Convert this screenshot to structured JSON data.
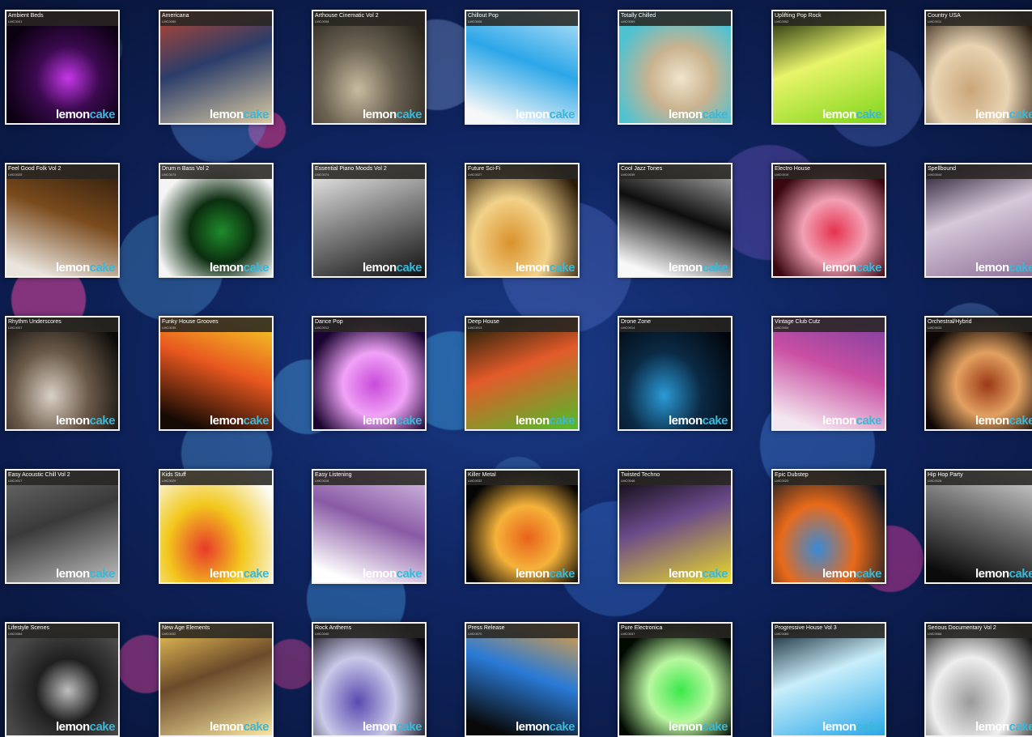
{
  "brand": {
    "logo_part_1": "lemon",
    "logo_part_2": "cake",
    "accent_color": "#3ab8d8"
  },
  "albums": [
    {
      "title": "Ambient Beds",
      "code": "LMC0001",
      "colors": [
        "#0a0010",
        "#c437e8",
        "#3b0a4f"
      ]
    },
    {
      "title": "Americana",
      "code": "LMC0050",
      "colors": [
        "#b8452f",
        "#d9c9a2",
        "#2b3d6a"
      ]
    },
    {
      "title": "Arthouse Cinematic Vol 2",
      "code": "LMC0008",
      "colors": [
        "#2a261e",
        "#c8bba0",
        "#6b6252"
      ]
    },
    {
      "title": "Chillout Pop",
      "code": "LMC0006",
      "colors": [
        "#f5f7f8",
        "#2ca6e8",
        "#b9e3f7"
      ]
    },
    {
      "title": "Totally Chilled",
      "code": "LMC0059",
      "colors": [
        "#4fc2d2",
        "#efe4cc",
        "#c9b28e"
      ]
    },
    {
      "title": "Uplifting Pop Rock",
      "code": "LMC0052",
      "colors": [
        "#0d1a03",
        "#7fd51a",
        "#e8f46a"
      ]
    },
    {
      "title": "Country USA",
      "code": "LMC0011",
      "colors": [
        "#2a1d10",
        "#c9a67a",
        "#e8d3b2"
      ]
    },
    {
      "title": "Feel Good Folk Vol 2",
      "code": "LMC0025",
      "colors": [
        "#e9e4dc",
        "#7a4a1d",
        "#2b1b0c"
      ]
    },
    {
      "title": "Drum n Bass Vol 2",
      "code": "LMC0073",
      "colors": [
        "#f4f4f4",
        "#1f8b2b",
        "#0c2e10"
      ]
    },
    {
      "title": "Essential Piano Moods Vol 2",
      "code": "LMC0074",
      "colors": [
        "#f2f2f2",
        "#111111",
        "#8a8a8a"
      ]
    },
    {
      "title": "Future Sci-Fi",
      "code": "LMC0027",
      "colors": [
        "#2b1a08",
        "#d9922c",
        "#f2d28a"
      ]
    },
    {
      "title": "Cool Jazz Tones",
      "code": "LMC0039",
      "colors": [
        "#f7f7f7",
        "#0e0e0e",
        "#b8b8b8"
      ]
    },
    {
      "title": "Electro House",
      "code": "LMC0019",
      "colors": [
        "#3a0610",
        "#e5334f",
        "#f2a0b4"
      ]
    },
    {
      "title": "Spellbound",
      "code": "LMC0044",
      "colors": [
        "#1b1226",
        "#8c6e96",
        "#d6c8d9"
      ]
    },
    {
      "title": "Rhythm Underscores",
      "code": "LMC0007",
      "colors": [
        "#0b0a09",
        "#d9d0c4",
        "#6b5a49"
      ]
    },
    {
      "title": "Funky House Grooves",
      "code": "LMC0035",
      "colors": [
        "#150a04",
        "#e8571f",
        "#f5d326"
      ]
    },
    {
      "title": "Dance Pop",
      "code": "LMC0012",
      "colors": [
        "#1a0430",
        "#c94bd9",
        "#f0a2f7"
      ]
    },
    {
      "title": "Deep House",
      "code": "LMC0013",
      "colors": [
        "#0b1a06",
        "#4fbd2a",
        "#e35a2a"
      ]
    },
    {
      "title": "Drone Zone",
      "code": "LMC0014",
      "colors": [
        "#02060c",
        "#2b9ad6",
        "#0b2a45"
      ]
    },
    {
      "title": "Vintage Club Cutz",
      "code": "LMC0054",
      "colors": [
        "#f4e6ef",
        "#c94fa3",
        "#7a3fa0"
      ]
    },
    {
      "title": "Orchestral/Hybrid",
      "code": "LMC0033",
      "colors": [
        "#0e0705",
        "#9b3a17",
        "#e2a060"
      ]
    },
    {
      "title": "Easy Acoustic Chill Vol 2",
      "code": "LMC0017",
      "colors": [
        "#6b6b6b",
        "#bdbdbd",
        "#3a3a3a"
      ]
    },
    {
      "title": "Kids Stuff",
      "code": "LMC0029",
      "colors": [
        "#fbfbf5",
        "#e83a2a",
        "#f2c81d"
      ]
    },
    {
      "title": "Easy Listening",
      "code": "LMC0018",
      "colors": [
        "#ffffff",
        "#8a5aa5",
        "#d9c3e6"
      ]
    },
    {
      "title": "Killer Metal",
      "code": "LMC0032",
      "colors": [
        "#050505",
        "#e8621a",
        "#f5b23a"
      ]
    },
    {
      "title": "Twisted Techno",
      "code": "LMC0048",
      "colors": [
        "#040404",
        "#e8d92a",
        "#6b4a8a"
      ]
    },
    {
      "title": "Epic Dubstep",
      "code": "LMC0020",
      "colors": [
        "#0a1624",
        "#3a8ad6",
        "#e86a1a"
      ]
    },
    {
      "title": "Hip Hop Party",
      "code": "LMC0028",
      "colors": [
        "#0b0b0b",
        "#6b6b6b",
        "#d8d8d8"
      ]
    },
    {
      "title": "Lifestyle Scenes",
      "code": "LMC0064",
      "colors": [
        "#4a4a4a",
        "#bfbfbf",
        "#1f1f1f"
      ]
    },
    {
      "title": "New Age Elements",
      "code": "LMC0032",
      "colors": [
        "#f2c85a",
        "#f8e6a0",
        "#6b4a2a"
      ]
    },
    {
      "title": "Rock Anthems",
      "code": "LMC0040",
      "colors": [
        "#0b0712",
        "#5a4ab0",
        "#c9c9e8"
      ]
    },
    {
      "title": "Press Release",
      "code": "LMC0070",
      "colors": [
        "#090909",
        "#2a7ad6",
        "#e8a03a"
      ]
    },
    {
      "title": "Pure Electronica",
      "code": "LMC0037",
      "colors": [
        "#020a02",
        "#3ae84a",
        "#b9f7a0"
      ]
    },
    {
      "title": "Progressive House Vol 3",
      "code": "LMC0083",
      "colors": [
        "#041624",
        "#2aa7e8",
        "#c9eefa"
      ]
    },
    {
      "title": "Serious Documentary Vol 2",
      "code": "LMC0066",
      "colors": [
        "#1a1a1a",
        "#9a9a9a",
        "#eeeeee"
      ]
    }
  ]
}
